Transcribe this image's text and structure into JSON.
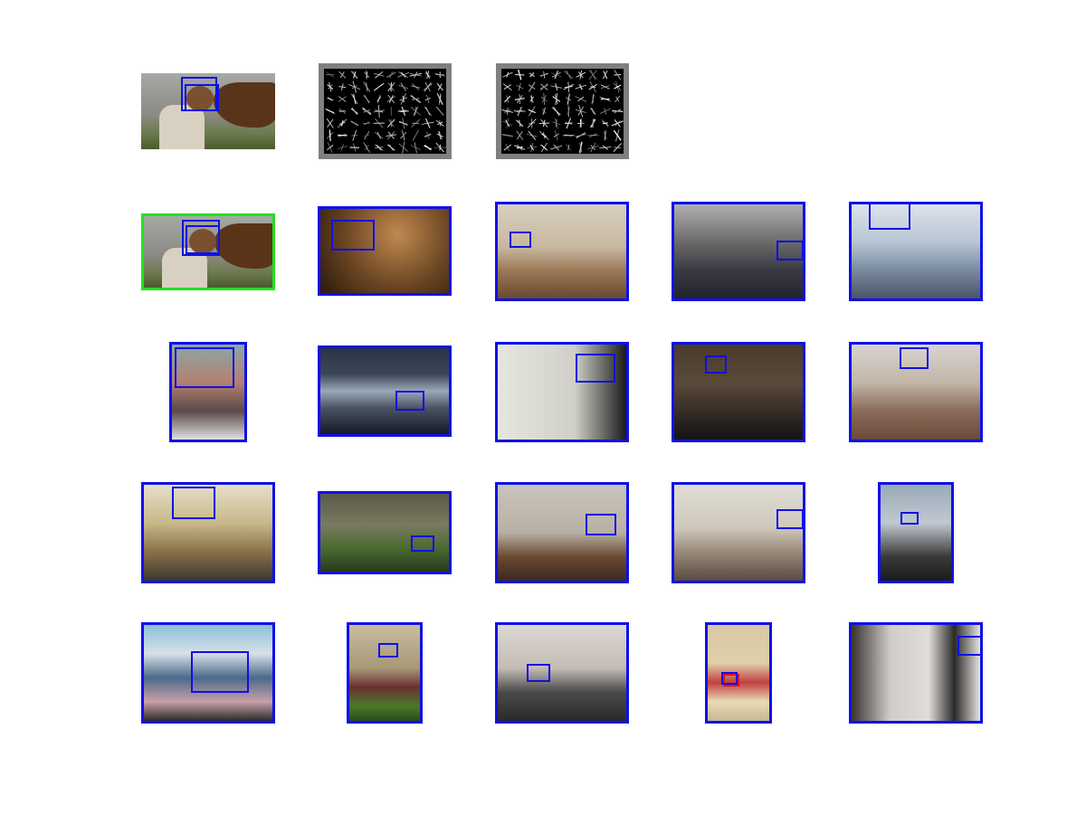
{
  "figure": {
    "description_free": true,
    "rows": 5,
    "columns": 5
  },
  "colors": {
    "detection_box": "#1010e8",
    "ground_truth_border": "#22e022",
    "hog_background": "#000000",
    "hog_frame": "#7f7f7f",
    "false_detection_box": "#e01010"
  },
  "panels": [
    {
      "id": "query",
      "kind": "photo"
    },
    {
      "id": "hog-1",
      "kind": "hog-visualization"
    },
    {
      "id": "hog-2",
      "kind": "hog-visualization"
    }
  ]
}
